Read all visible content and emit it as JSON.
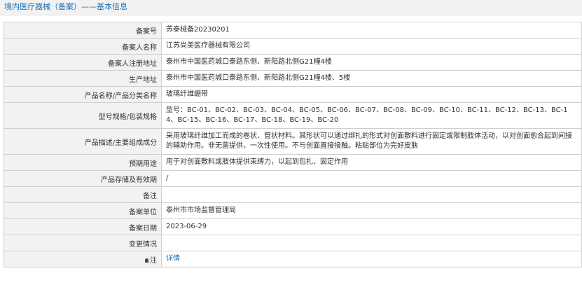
{
  "header": {
    "title": "境内医疗器械（备案）",
    "separator": "——",
    "subtitle": "基本信息"
  },
  "rows": [
    {
      "label": "备案号",
      "value": "苏泰械备20230201"
    },
    {
      "label": "备案人名称",
      "value": "江苏尚美医疗器械有限公司"
    },
    {
      "label": "备案人注册地址",
      "value": "泰州市中国医药城口泰路东侧、新阳路北侧G21幢4楼"
    },
    {
      "label": "生产地址",
      "value": "泰州市中国医药城口泰路东侧、新阳路北侧G21幢4楼、5楼"
    },
    {
      "label": "产品名称/产品分类名称",
      "value": "玻璃纤维绷带"
    },
    {
      "label": "型号规格/包装规格",
      "value": "型号：BC-01、BC-02、BC-03、BC-04、BC-05、BC-06、BC-07、BC-08、BC-09、BC-10、BC-11、BC-12、BC-13、BC-14、BC-15、BC-16、BC-17、BC-18、BC-19、BC-20"
    },
    {
      "label": "产品描述/主要组成成分",
      "value": "采用玻璃纤维加工而成的卷状、管状材料。其形状可以通过绑扎的形式对创面敷料进行固定或限制肢体活动，以对创面愈合起到间接的辅助作用。非无菌提供，一次性使用。不与创面直接接触。粘贴部位为完好皮肤"
    },
    {
      "label": "预期用途",
      "value": "用于对创面敷料或肢体提供束缚力，以起到包扎、固定作用"
    },
    {
      "label": "产品存储及有效期",
      "value": "/"
    },
    {
      "label": "备注",
      "value": ""
    },
    {
      "label": "备案单位",
      "value": "泰州市市场监督管理局"
    },
    {
      "label": "备案日期",
      "value": "2023-06-29"
    },
    {
      "label": "变更情况",
      "value": ""
    },
    {
      "label": "注",
      "value": "详情",
      "icon": "lightbulb-icon"
    }
  ]
}
